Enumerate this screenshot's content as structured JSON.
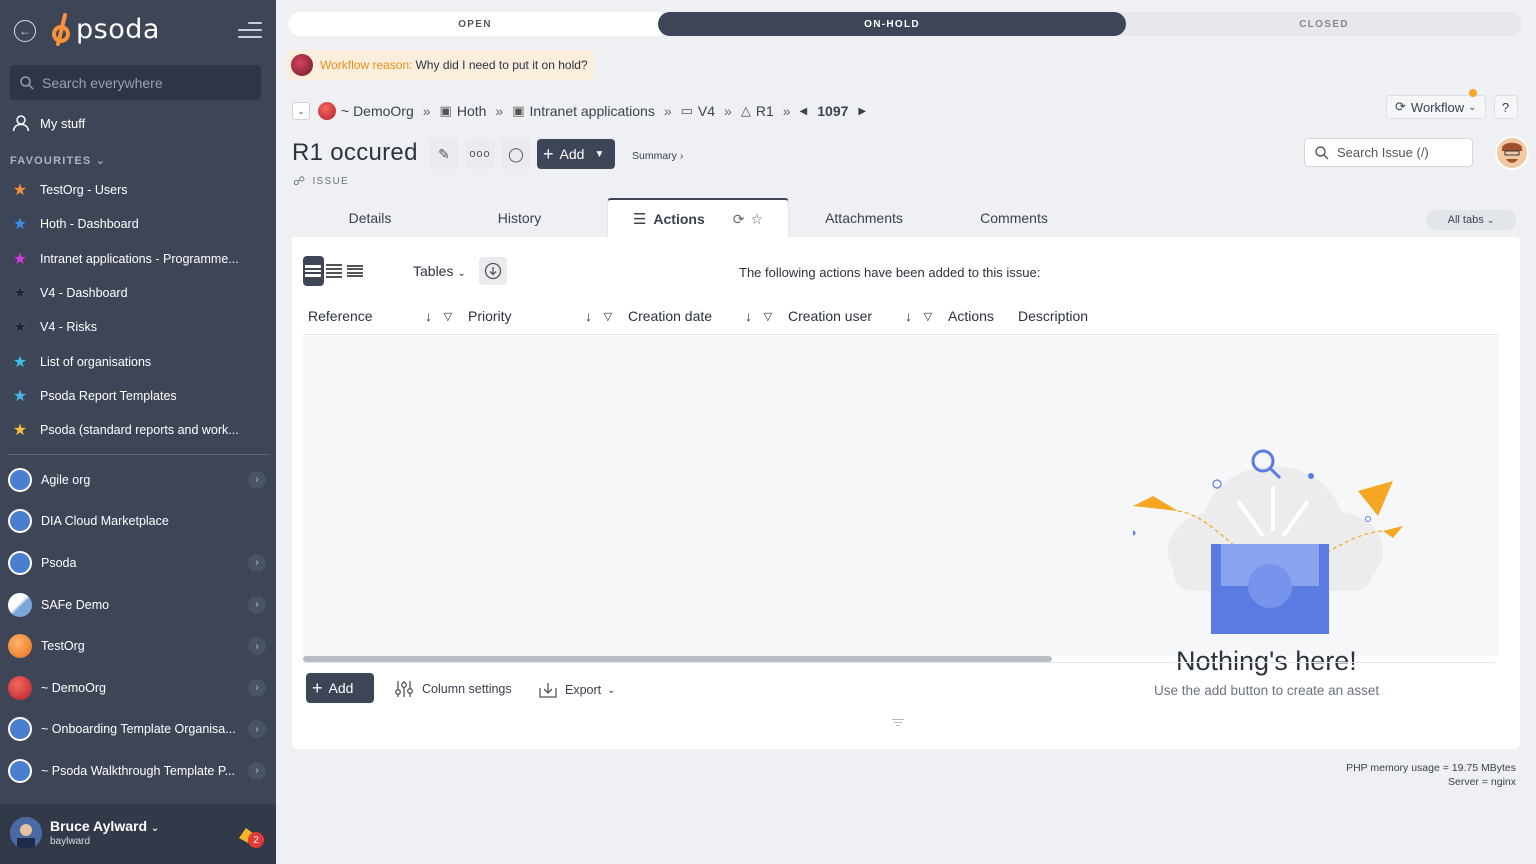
{
  "sidebar": {
    "logo_text": "psoda",
    "search_placeholder": "Search everywhere",
    "my_stuff": "My stuff",
    "favourites_heading": "FAVOURITES",
    "favourites": [
      {
        "label": "TestOrg - Users",
        "color": "#f7923a"
      },
      {
        "label": "Hoth - Dashboard",
        "color": "#3b8fe8"
      },
      {
        "label": "Intranet applications - Programme...",
        "color": "#d63bd6"
      },
      {
        "label": "V4 - Dashboard",
        "color": "#1f2430"
      },
      {
        "label": "V4 - Risks",
        "color": "#1f2430"
      },
      {
        "label": "List of organisations",
        "color": "#3bc1e8"
      },
      {
        "label": "Psoda Report Templates",
        "color": "#4fb6e8"
      },
      {
        "label": "Psoda (standard reports and work...",
        "color": "#f5c23a"
      }
    ],
    "organisations": [
      {
        "label": "Agile org",
        "icon": "compass",
        "chevron": true
      },
      {
        "label": "DIA Cloud Marketplace",
        "icon": "compass",
        "chevron": false
      },
      {
        "label": "Psoda",
        "icon": "compass",
        "chevron": true
      },
      {
        "label": "SAFe Demo",
        "icon": "safe",
        "chevron": true
      },
      {
        "label": "TestOrg",
        "icon": "orange",
        "chevron": true
      },
      {
        "label": "~ DemoOrg",
        "icon": "red",
        "chevron": true
      },
      {
        "label": "~ Onboarding Template Organisa...",
        "icon": "compass",
        "chevron": true
      },
      {
        "label": "~ Psoda Walkthrough Template P...",
        "icon": "compass",
        "chevron": true
      }
    ],
    "user": {
      "name": "Bruce Aylward",
      "login": "baylward",
      "notifications": "2"
    }
  },
  "status": {
    "open": "OPEN",
    "on_hold": "ON-HOLD",
    "closed": "CLOSED"
  },
  "workflow_reason": {
    "label": "Workflow reason:",
    "text": "Why did I need to put it on hold?"
  },
  "breadcrumb": {
    "items": [
      "~ DemoOrg",
      "Hoth",
      "Intranet applications",
      "V4",
      "R1"
    ],
    "number": "1097"
  },
  "workflow_button": "Workflow",
  "help_button": "?",
  "issue": {
    "title": "R1 occured",
    "type": "ISSUE"
  },
  "toolbar": {
    "add": "Add",
    "summary": "Summary ›"
  },
  "search_issue_placeholder": "Search Issue (/)",
  "tabs": [
    "Details",
    "History",
    "Actions",
    "Attachments",
    "Comments"
  ],
  "all_tabs": "All tabs",
  "panel": {
    "tables_label": "Tables",
    "info": "The following actions have been added to this issue:",
    "columns": [
      "Reference",
      "Priority",
      "Creation date",
      "Creation user",
      "Actions",
      "Description"
    ],
    "empty_title": "Nothing's here!",
    "empty_sub": "Use the add button to create an asset",
    "add": "Add",
    "column_settings": "Column settings",
    "export": "Export"
  },
  "footer": {
    "memory": "PHP memory usage = 19.75 MBytes",
    "server": "Server = nginx"
  }
}
